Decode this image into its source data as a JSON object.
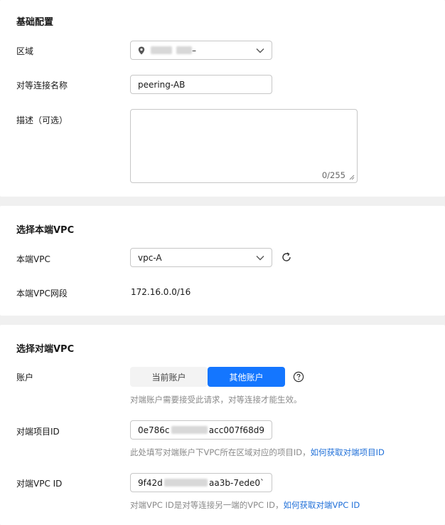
{
  "basic": {
    "title": "基础配置",
    "region_label": "区域",
    "region_value_suffix": "–",
    "name_label": "对等连接名称",
    "name_value": "peering-AB",
    "desc_label": "描述（可选）",
    "desc_counter": "0/255"
  },
  "local": {
    "title": "选择本端VPC",
    "vpc_label": "本端VPC",
    "vpc_value": "vpc-A",
    "cidr_label": "本端VPC网段",
    "cidr_value": "172.16.0.0/16"
  },
  "peer": {
    "title": "选择对端VPC",
    "account_label": "账户",
    "account_options": [
      "当前账户",
      "其他账户"
    ],
    "account_selected": "其他账户",
    "account_hint": "对端账户需要接受此请求，对等连接才能生效。",
    "project_label": "对端项目ID",
    "project_value_prefix": "0e786c",
    "project_value_suffix": "acc007f68d9",
    "project_hint": "此处填写对端账户下VPC所在区域对应的项目ID，",
    "project_link": "如何获取对端项目ID",
    "vpcid_label": "对端VPC ID",
    "vpcid_value_prefix": "9f42d",
    "vpcid_value_suffix": "aa3b-7ede0`",
    "vpcid_hint": "对端VPC ID是对等连接另一端的VPC ID，",
    "vpcid_link": "如何获取对端VPC ID"
  },
  "colors": {
    "primary": "#1476ff",
    "link": "#1f6fd8",
    "page_bg": "#f0f0f0"
  }
}
